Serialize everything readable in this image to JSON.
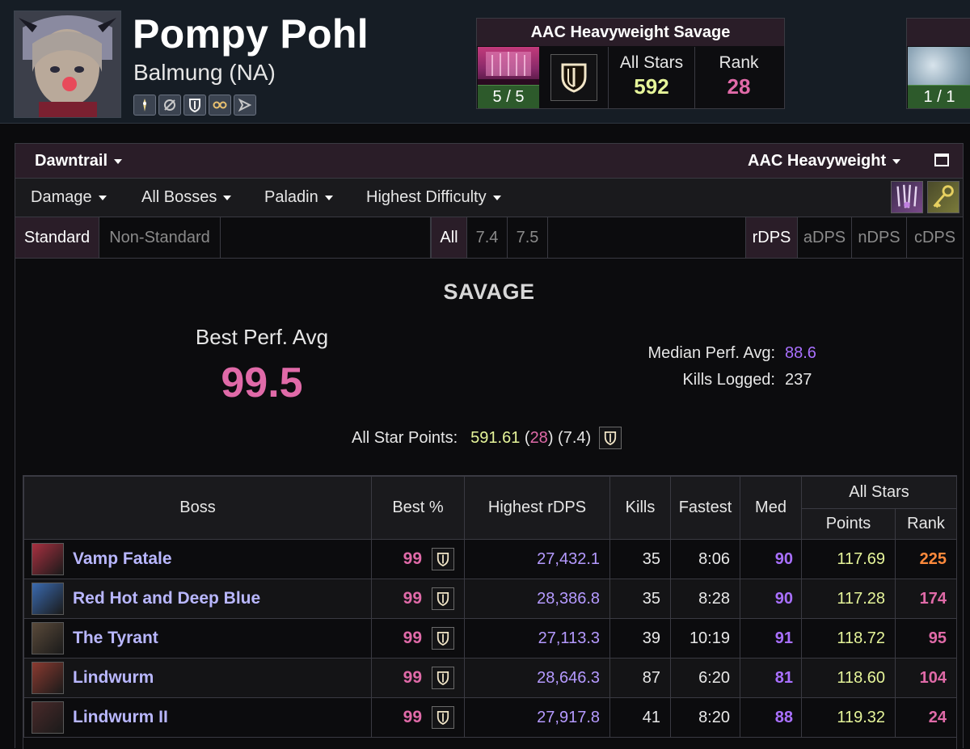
{
  "character": {
    "name": "Pompy Pohl",
    "server": "Balmung (NA)",
    "job_icons": [
      "white-mage-icon",
      "scholar-icon",
      "paladin-icon",
      "astrologian-icon",
      "dragoon-icon"
    ]
  },
  "tier_card": {
    "title": "AAC Heavyweight Savage",
    "progress": "5 / 5",
    "all_stars_label": "All Stars",
    "all_stars_value": "592",
    "rank_label": "Rank",
    "rank_value": "28"
  },
  "tier_card_2": {
    "progress": "1 / 1"
  },
  "filters": {
    "expansion": "Dawntrail",
    "zone": "AAC Heavyweight",
    "metric": "Damage",
    "bosses": "All Bosses",
    "spec": "Paladin",
    "difficulty": "Highest Difficulty"
  },
  "tabs": {
    "standard": "Standard",
    "non_standard": "Non-Standard",
    "all": "All",
    "v74": "7.4",
    "v75": "7.5",
    "rdps": "rDPS",
    "adps": "aDPS",
    "ndps": "nDPS",
    "cdps": "cDPS"
  },
  "summary": {
    "title": "SAVAGE",
    "best_label": "Best Perf. Avg",
    "best_value": "99.5",
    "median_label": "Median Perf. Avg:",
    "median_value": "88.6",
    "kills_label": "Kills Logged:",
    "kills_value": "237",
    "asp_label": "All Star Points:",
    "asp_points": "591.61",
    "asp_rank": "28",
    "asp_patch": "(7.4)"
  },
  "table": {
    "headers": {
      "boss": "Boss",
      "best": "Best %",
      "highest": "Highest rDPS",
      "kills": "Kills",
      "fastest": "Fastest",
      "med": "Med",
      "all_stars": "All Stars",
      "points": "Points",
      "rank": "Rank"
    },
    "rows": [
      {
        "boss": "Vamp Fatale",
        "best": "99",
        "rdps": "27,432.1",
        "kills": "35",
        "fastest": "8:06",
        "med": "90",
        "points": "117.69",
        "rank": "225",
        "thumb_color": "#a83040"
      },
      {
        "boss": "Red Hot and Deep Blue",
        "best": "99",
        "rdps": "28,386.8",
        "kills": "35",
        "fastest": "8:28",
        "med": "90",
        "points": "117.28",
        "rank": "174",
        "thumb_color": "#3a6ab0"
      },
      {
        "boss": "The Tyrant",
        "best": "99",
        "rdps": "27,113.3",
        "kills": "39",
        "fastest": "10:19",
        "med": "91",
        "points": "118.72",
        "rank": "95",
        "thumb_color": "#5a4a3a"
      },
      {
        "boss": "Lindwurm",
        "best": "99",
        "rdps": "28,646.3",
        "kills": "87",
        "fastest": "6:20",
        "med": "81",
        "points": "118.60",
        "rank": "104",
        "thumb_color": "#8a3a30"
      },
      {
        "boss": "Lindwurm II",
        "best": "99",
        "rdps": "27,917.8",
        "kills": "41",
        "fastest": "8:20",
        "med": "88",
        "points": "119.32",
        "rank": "24",
        "thumb_color": "#4a2a2a"
      }
    ]
  },
  "colors": {
    "accent_pink": "#e06aa8",
    "accent_purple": "#a970ff",
    "accent_yellow": "#e6f59a",
    "rank_orange": "#ff8a3c",
    "header_bar": "#2a1d28",
    "progress_green": "#2d5a2b"
  }
}
